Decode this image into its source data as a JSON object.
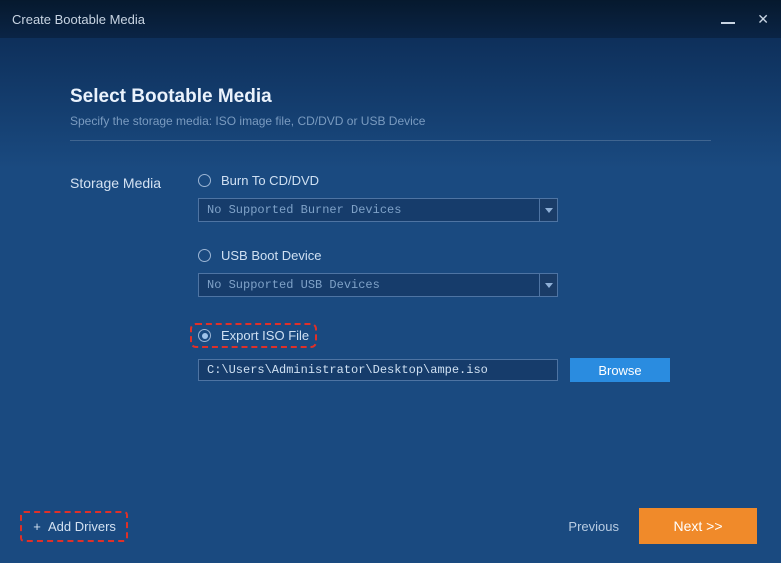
{
  "window": {
    "title": "Create Bootable Media"
  },
  "header": {
    "title": "Select Bootable Media",
    "subtitle": "Specify the storage media: ISO image file, CD/DVD or USB Device"
  },
  "label": "Storage Media",
  "options": {
    "cd": {
      "label": "Burn To CD/DVD",
      "dropdown": "No Supported Burner Devices"
    },
    "usb": {
      "label": "USB Boot Device",
      "dropdown": "No Supported USB Devices"
    },
    "iso": {
      "label": "Export ISO File",
      "path": "C:\\Users\\Administrator\\Desktop\\ampe.iso",
      "browse": "Browse"
    }
  },
  "footer": {
    "add_drivers": "Add Drivers",
    "previous": "Previous",
    "next": "Next >>"
  }
}
